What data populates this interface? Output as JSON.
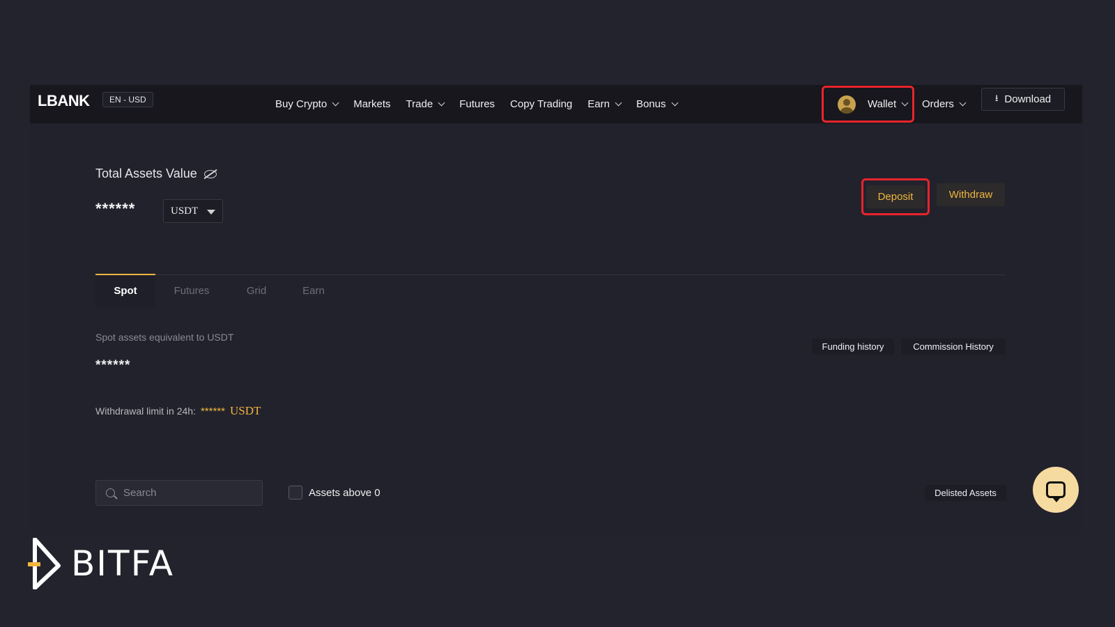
{
  "header": {
    "logo": "LBANK",
    "lang_currency": "EN - USD",
    "nav": [
      {
        "label": "Buy Crypto",
        "dropdown": true
      },
      {
        "label": "Markets",
        "dropdown": false
      },
      {
        "label": "Trade",
        "dropdown": true
      },
      {
        "label": "Futures",
        "dropdown": false
      },
      {
        "label": "Copy Trading",
        "dropdown": false
      },
      {
        "label": "Earn",
        "dropdown": true
      },
      {
        "label": "Bonus",
        "dropdown": true
      }
    ],
    "wallet_label": "Wallet",
    "orders_label": "Orders",
    "download_label": "Download"
  },
  "assets": {
    "total_label": "Total Assets Value",
    "total_value": "******",
    "currency": "USDT",
    "deposit_label": "Deposit",
    "withdraw_label": "Withdraw"
  },
  "tabs": [
    {
      "label": "Spot",
      "active": true
    },
    {
      "label": "Futures",
      "active": false
    },
    {
      "label": "Grid",
      "active": false
    },
    {
      "label": "Earn",
      "active": false
    }
  ],
  "spot": {
    "label": "Spot assets equivalent to USDT",
    "value": "******",
    "withdrawal_limit_label": "Withdrawal limit in 24h:",
    "withdrawal_limit_value": "******",
    "withdrawal_limit_currency": "USDT",
    "funding_history_label": "Funding history",
    "commission_history_label": "Commission History"
  },
  "filters": {
    "search_placeholder": "Search",
    "assets_above_zero_label": "Assets above 0",
    "delisted_assets_label": "Delisted Assets"
  },
  "watermark": {
    "text": "BITFA"
  },
  "colors": {
    "accent": "#f0b640",
    "highlight": "#e8242c",
    "background": "#22222c",
    "topbar": "#17171d"
  }
}
